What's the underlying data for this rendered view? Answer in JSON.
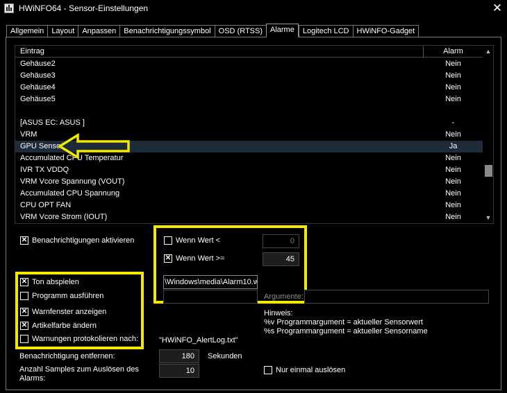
{
  "window": {
    "title": "HWiNFO64 - Sensor-Einstellungen",
    "close_glyph": "✕"
  },
  "tabs": [
    {
      "label": "Allgemein",
      "active": false
    },
    {
      "label": "Layout",
      "active": false
    },
    {
      "label": "Anpassen",
      "active": false
    },
    {
      "label": "Benachrichtigungssymbol",
      "active": false
    },
    {
      "label": "OSD (RTSS)",
      "active": false
    },
    {
      "label": "Alarme",
      "active": true
    },
    {
      "label": "Logitech LCD",
      "active": false
    },
    {
      "label": "HWiNFO-Gadget",
      "active": false
    }
  ],
  "list": {
    "headers": {
      "entry": "Eintrag",
      "alarm": "Alarm"
    },
    "rows": [
      {
        "entry": "Gehäuse2",
        "alarm": "Nein",
        "selected": false
      },
      {
        "entry": "Gehäuse3",
        "alarm": "Nein",
        "selected": false
      },
      {
        "entry": "Gehäuse4",
        "alarm": "Nein",
        "selected": false
      },
      {
        "entry": "Gehäuse5",
        "alarm": "Nein",
        "selected": false
      },
      {
        "entry": "",
        "alarm": "",
        "selected": false
      },
      {
        "entry": "[ASUS EC: ASUS ]",
        "alarm": "-",
        "selected": false
      },
      {
        "entry": "VRM",
        "alarm": "Nein",
        "selected": false
      },
      {
        "entry": "GPU Sensor",
        "alarm": "Ja",
        "selected": true
      },
      {
        "entry": "Accumulated CPU Temperatur",
        "alarm": "Nein",
        "selected": false
      },
      {
        "entry": "IVR TX VDDQ",
        "alarm": "Nein",
        "selected": false
      },
      {
        "entry": "VRM Vcore Spannung (VOUT)",
        "alarm": "Nein",
        "selected": false
      },
      {
        "entry": "Accumulated CPU Spannung",
        "alarm": "Nein",
        "selected": false
      },
      {
        "entry": "CPU OPT  FAN",
        "alarm": "Nein",
        "selected": false
      },
      {
        "entry": "VRM Vcore Strom (IOUT)",
        "alarm": "Nein",
        "selected": false
      }
    ],
    "scroll_up_glyph": "▲",
    "scroll_down_glyph": "▼"
  },
  "options": {
    "enable_notifications": {
      "label": "Benachrichtigungen aktivieren",
      "checked": true
    },
    "value_below": {
      "label": "Wenn Wert <",
      "checked": false,
      "value": "0"
    },
    "value_at_least": {
      "label": "Wenn Wert >=",
      "checked": true,
      "value": "45"
    },
    "sound_file": "\\Windows\\media\\Alarm10.w",
    "program_path": "",
    "arguments_label": "Argumente:",
    "arguments_value": "",
    "play_sound": {
      "label": "Ton abspielen",
      "checked": true
    },
    "run_program": {
      "label": "Programm ausführen",
      "checked": false
    },
    "show_warning_window": {
      "label": "Warnfenster anzeigen",
      "checked": true
    },
    "change_item_color": {
      "label": "Artikelfarbe ändern",
      "checked": true
    },
    "log_warnings": {
      "label": "Warnungen protokolieren nach:",
      "checked": false
    },
    "log_file": "\"HWiNFO_AlertLog.txt\"",
    "hint": {
      "title": "Hinweis:",
      "line1": "%v Programmargument = aktueller Sensorwert",
      "line2": "%s Programmargument = aktueller Sensorname"
    },
    "remove_notification": {
      "label": "Benachrichtigung entfernen:",
      "value": "180",
      "unit": "Sekunden"
    },
    "samples_to_trigger": {
      "label_line1": "Anzahl Samples zum Auslösen des",
      "label_line2": "Alarms:",
      "value": "10"
    },
    "trigger_once": {
      "label": "Nur einmal auslösen",
      "checked": false
    }
  },
  "colors": {
    "highlight": "#f5e800",
    "selection": "#1d2b3a",
    "background": "#000000"
  }
}
